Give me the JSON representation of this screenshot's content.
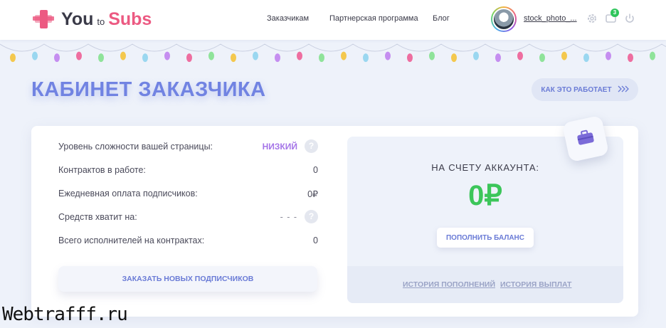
{
  "header": {
    "logo": {
      "you": "You",
      "to": "to",
      "subs": "Subs"
    },
    "nav": [
      "Заказчикам",
      "Партнерская программа",
      "Блог"
    ],
    "username": "stock_photo_...",
    "notification_count": "3",
    "icons": [
      "gear-icon",
      "chat-icon",
      "power-icon"
    ]
  },
  "page_title": "КАБИНЕТ ЗАКАЗЧИКА",
  "how_it_works": "КАК ЭТО РАБОТАЕТ",
  "stats": [
    {
      "label": "Уровень сложности вашей страницы:",
      "value": "НИЗКИЙ"
    },
    {
      "label": "Контрактов в работе:",
      "value": "0"
    },
    {
      "label": "Ежедневная оплата подписчиков:",
      "value": "0₽"
    },
    {
      "label": "Средств хватит на:",
      "value": "- - -"
    },
    {
      "label": "Всего исполнителей на контрактах:",
      "value": "0"
    }
  ],
  "order_button": "ЗАКАЗАТЬ НОВЫХ ПОДПИСЧИКОВ",
  "balance": {
    "label": "НА СЧЕТУ АККАУНТА:",
    "amount": "0₽",
    "topup_button": "ПОПОЛНИТЬ БАЛАНС",
    "history_topups": "ИСТОРИЯ ПОПОЛНЕНИЙ",
    "history_payouts": "ИСТОРИЯ ВЫПЛАТ"
  },
  "watermark": "Webtrafff.ru",
  "colors": {
    "accent": "#7183e2",
    "brand_pink": "#ec5a82",
    "balance_green": "#3cc65a",
    "level_purple": "#a575e8"
  }
}
